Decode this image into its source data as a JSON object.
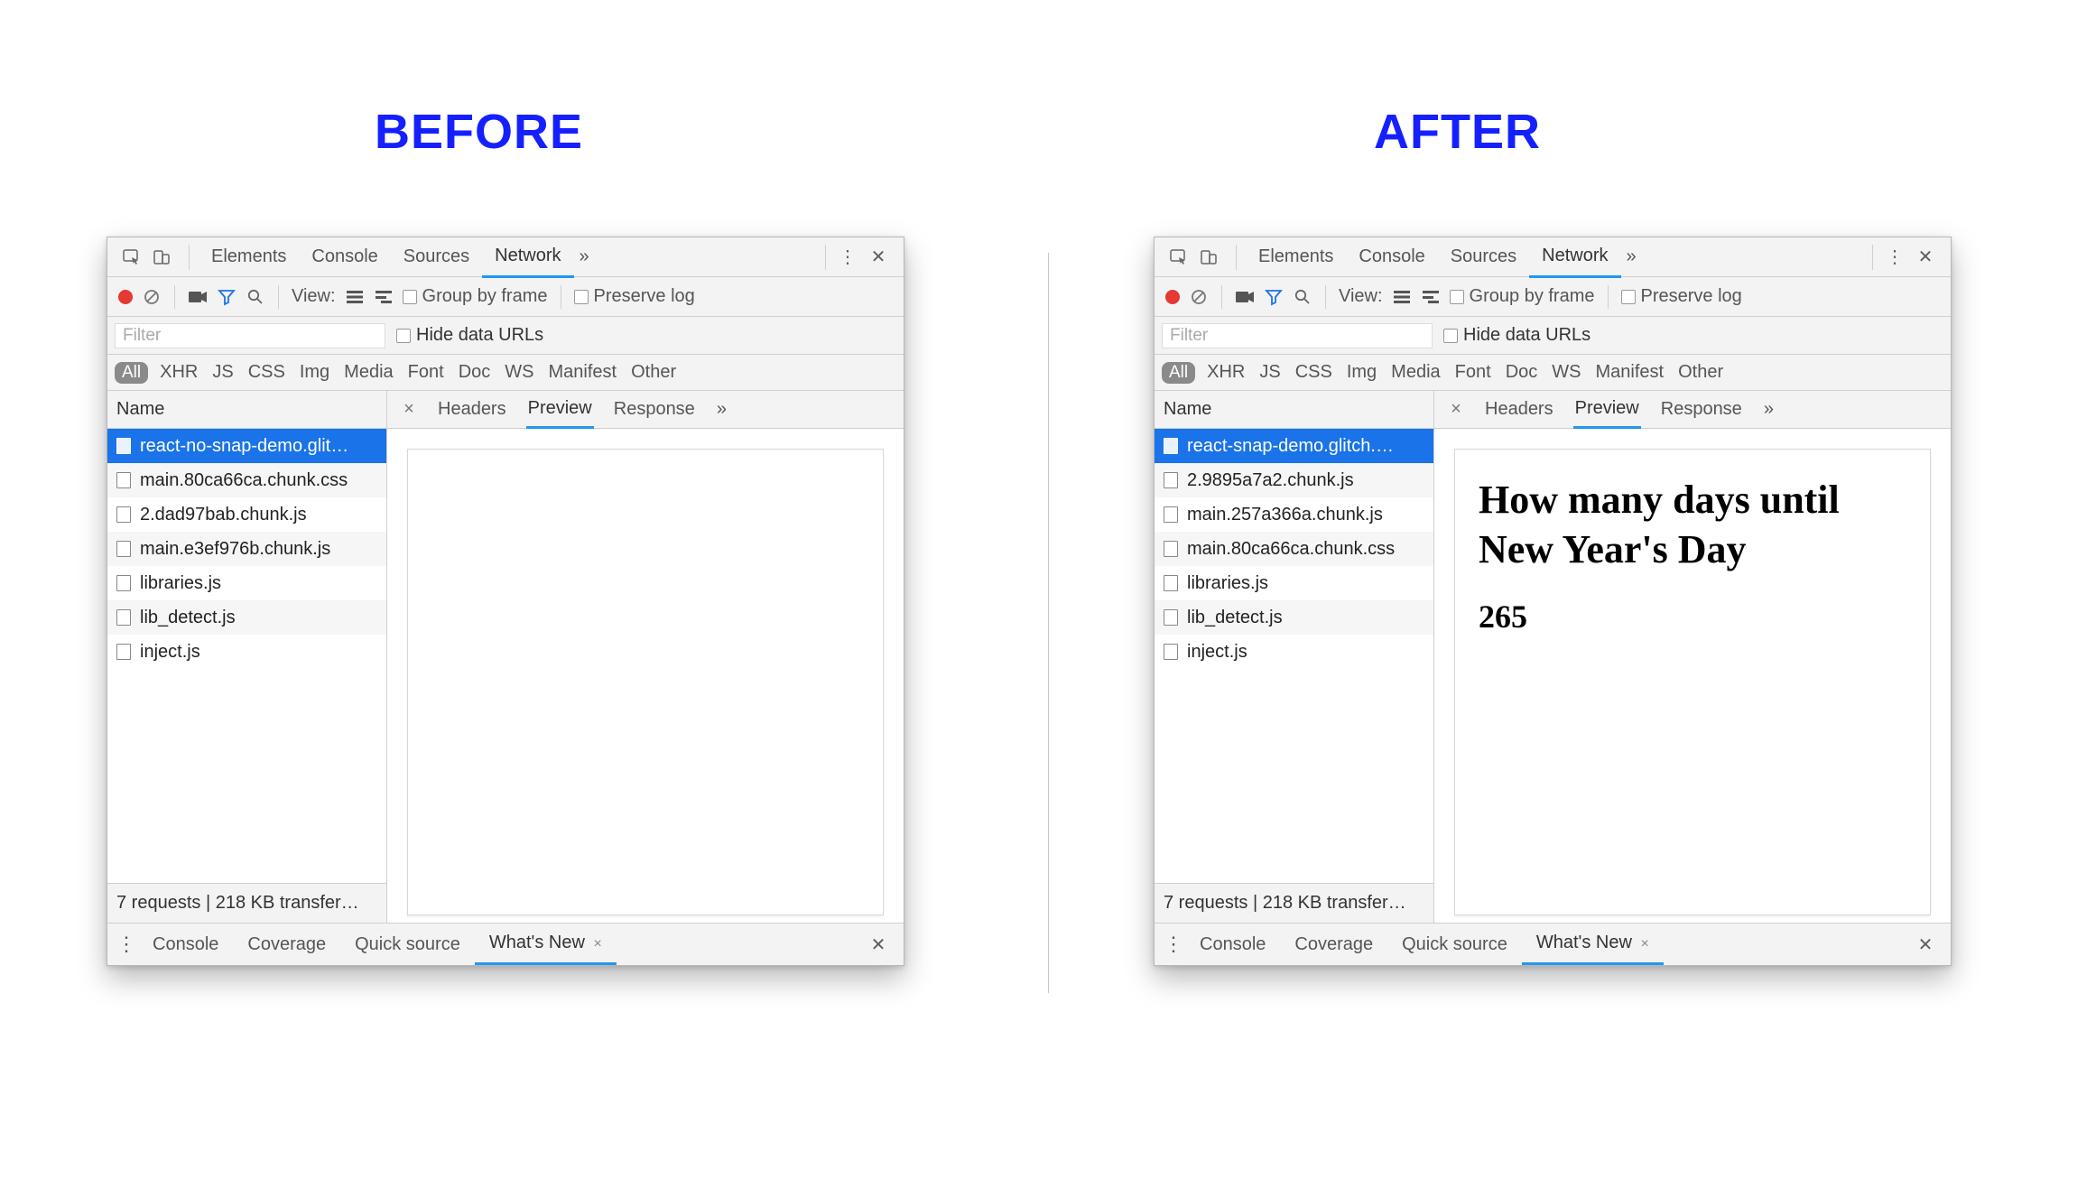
{
  "headings": {
    "before": "BEFORE",
    "after": "AFTER"
  },
  "mainTabs": {
    "items": [
      "Elements",
      "Console",
      "Sources",
      "Network"
    ],
    "active": "Network",
    "more": "»"
  },
  "toolbar": {
    "viewLabel": "View:",
    "groupByFrame": "Group by frame",
    "preserveLog": "Preserve log"
  },
  "filterbar": {
    "placeholder": "Filter",
    "hideDataUrls": "Hide data URLs"
  },
  "typeRow": [
    "All",
    "XHR",
    "JS",
    "CSS",
    "Img",
    "Media",
    "Font",
    "Doc",
    "WS",
    "Manifest",
    "Other"
  ],
  "reqHeader": "Name",
  "subtabs": {
    "items": [
      "Headers",
      "Preview",
      "Response"
    ],
    "active": "Preview",
    "more": "»",
    "close": "×"
  },
  "drawer": {
    "items": [
      "Console",
      "Coverage",
      "Quick source",
      "What's New"
    ],
    "active": "What's New",
    "closeGlyph": "×"
  },
  "before": {
    "requests": [
      "react-no-snap-demo.glit…",
      "main.80ca66ca.chunk.css",
      "2.dad97bab.chunk.js",
      "main.e3ef976b.chunk.js",
      "libraries.js",
      "lib_detect.js",
      "inject.js"
    ],
    "selectedIndex": 0,
    "footer": "7 requests | 218 KB transfer…",
    "preview": {
      "title": "",
      "value": ""
    }
  },
  "after": {
    "requests": [
      "react-snap-demo.glitch.…",
      "2.9895a7a2.chunk.js",
      "main.257a366a.chunk.js",
      "main.80ca66ca.chunk.css",
      "libraries.js",
      "lib_detect.js",
      "inject.js"
    ],
    "selectedIndex": 0,
    "footer": "7 requests | 218 KB transfer…",
    "preview": {
      "title": "How many days until New Year's Day",
      "value": "265"
    }
  }
}
